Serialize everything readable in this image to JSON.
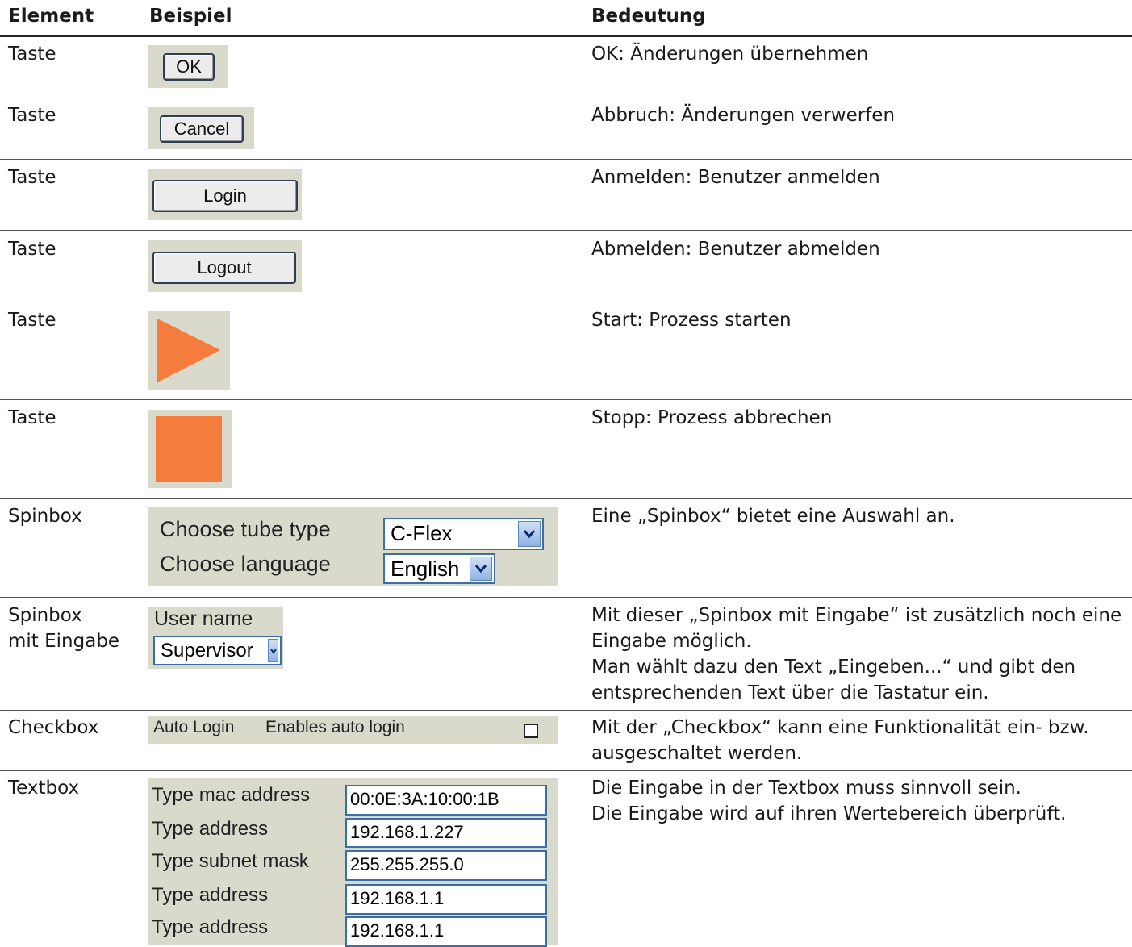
{
  "table": {
    "headers": {
      "element": "Element",
      "example": "Beispiel",
      "meaning": "Bedeutung"
    },
    "rows": [
      {
        "element": "Taste",
        "example_label": "OK",
        "meaning": [
          "OK: Änderungen übernehmen"
        ]
      },
      {
        "element": "Taste",
        "example_label": "Cancel",
        "meaning": [
          "Abbruch: Änderungen verwerfen"
        ]
      },
      {
        "element": "Taste",
        "example_label": "Login",
        "meaning": [
          "Anmelden: Benutzer anmelden"
        ]
      },
      {
        "element": "Taste",
        "example_label": "Logout",
        "meaning": [
          "Abmelden: Benutzer abmelden"
        ]
      },
      {
        "element": "Taste",
        "example_icon": "play-icon",
        "meaning": [
          "Start: Prozess starten"
        ]
      },
      {
        "element": "Taste",
        "example_icon": "stop-icon",
        "meaning": [
          "Stopp: Prozess abbrechen"
        ]
      },
      {
        "element": "Spinbox",
        "example": {
          "fields": [
            {
              "label": "Choose tube type",
              "value": "C-Flex"
            },
            {
              "label": "Choose language",
              "value": "English"
            }
          ]
        },
        "meaning": [
          "Eine „Spinbox“ bietet eine Auswahl an."
        ]
      },
      {
        "element": [
          "Spinbox",
          "mit Eingabe"
        ],
        "example": {
          "label": "User name",
          "value": "Supervisor"
        },
        "meaning": [
          "Mit dieser „Spinbox mit Eingabe“ ist zusätzlich noch eine",
          "Eingabe möglich.",
          "Man wählt dazu den Text „Eingeben...“ und gibt den",
          "entsprechenden Text über die Tastatur ein."
        ]
      },
      {
        "element": "Checkbox",
        "example": {
          "label": "Auto Login",
          "description": "Enables auto login",
          "checked": false
        },
        "meaning": [
          "Mit der „Checkbox“ kann eine Funktionalität ein- bzw.",
          "ausgeschaltet werden."
        ]
      },
      {
        "element": "Textbox",
        "example": {
          "fields": [
            {
              "label": "Type mac address",
              "value": "00:0E:3A:10:00:1B"
            },
            {
              "label": "Type address",
              "value": "192.168.1.227"
            },
            {
              "label": "Type subnet mask",
              "value": "255.255.255.0"
            },
            {
              "label": "Type address",
              "value": "192.168.1.1"
            },
            {
              "label": "Type address",
              "value": "192.168.1.1"
            }
          ]
        },
        "meaning": [
          "Die Eingabe in der Textbox muss sinnvoll sein.",
          "Die Eingabe wird auf ihren Wertebereich überprüft."
        ]
      }
    ]
  },
  "colors": {
    "panel": "#d9d9cc",
    "accent_orange": "#f47c3c",
    "control_border": "#3a6ea5"
  }
}
